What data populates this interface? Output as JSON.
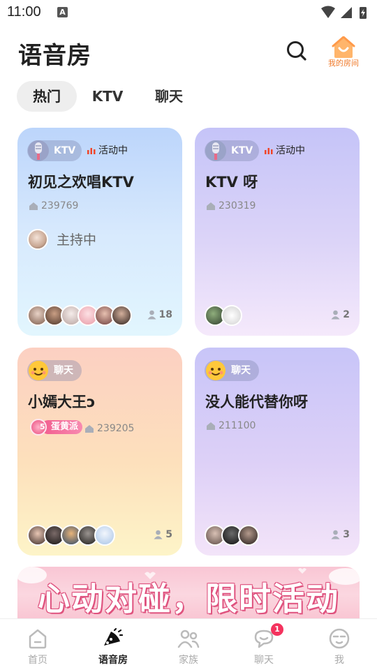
{
  "status_bar": {
    "time": "11:00",
    "notification_icon": "A"
  },
  "header": {
    "title": "语音房",
    "my_room_label": "我的房间"
  },
  "tabs": [
    {
      "label": "热门",
      "active": true
    },
    {
      "label": "KTV",
      "active": false
    },
    {
      "label": "聊天",
      "active": false
    }
  ],
  "rooms": [
    {
      "tag": "KTV",
      "live_label": "活动中",
      "title": "初见之欢唱KTV",
      "room_id": "239769",
      "host_label": "主持中",
      "member_count": "18"
    },
    {
      "tag": "KTV",
      "live_label": "活动中",
      "title": "KTV 呀",
      "room_id": "230319",
      "member_count": "2"
    },
    {
      "tag": "聊天",
      "title": "小嫣大王ↄ",
      "family_level": "5",
      "family_name": "蛋黄派",
      "room_id": "239205",
      "member_count": "5"
    },
    {
      "tag": "聊天",
      "title": "没人能代替你呀",
      "room_id": "211100",
      "member_count": "3"
    }
  ],
  "banner": {
    "text": "心动对碰，限时活动"
  },
  "bottom_nav": [
    {
      "label": "首页",
      "icon": "home-icon",
      "active": false
    },
    {
      "label": "语音房",
      "icon": "voice-room-icon",
      "active": true
    },
    {
      "label": "家族",
      "icon": "family-icon",
      "active": false
    },
    {
      "label": "聊天",
      "icon": "chat-icon",
      "active": false,
      "badge": "1"
    },
    {
      "label": "我",
      "icon": "profile-icon",
      "active": false
    }
  ],
  "colors": {
    "accent_orange": "#f07a2a",
    "badge_red": "#f4335e",
    "live_red": "#f0462a"
  }
}
